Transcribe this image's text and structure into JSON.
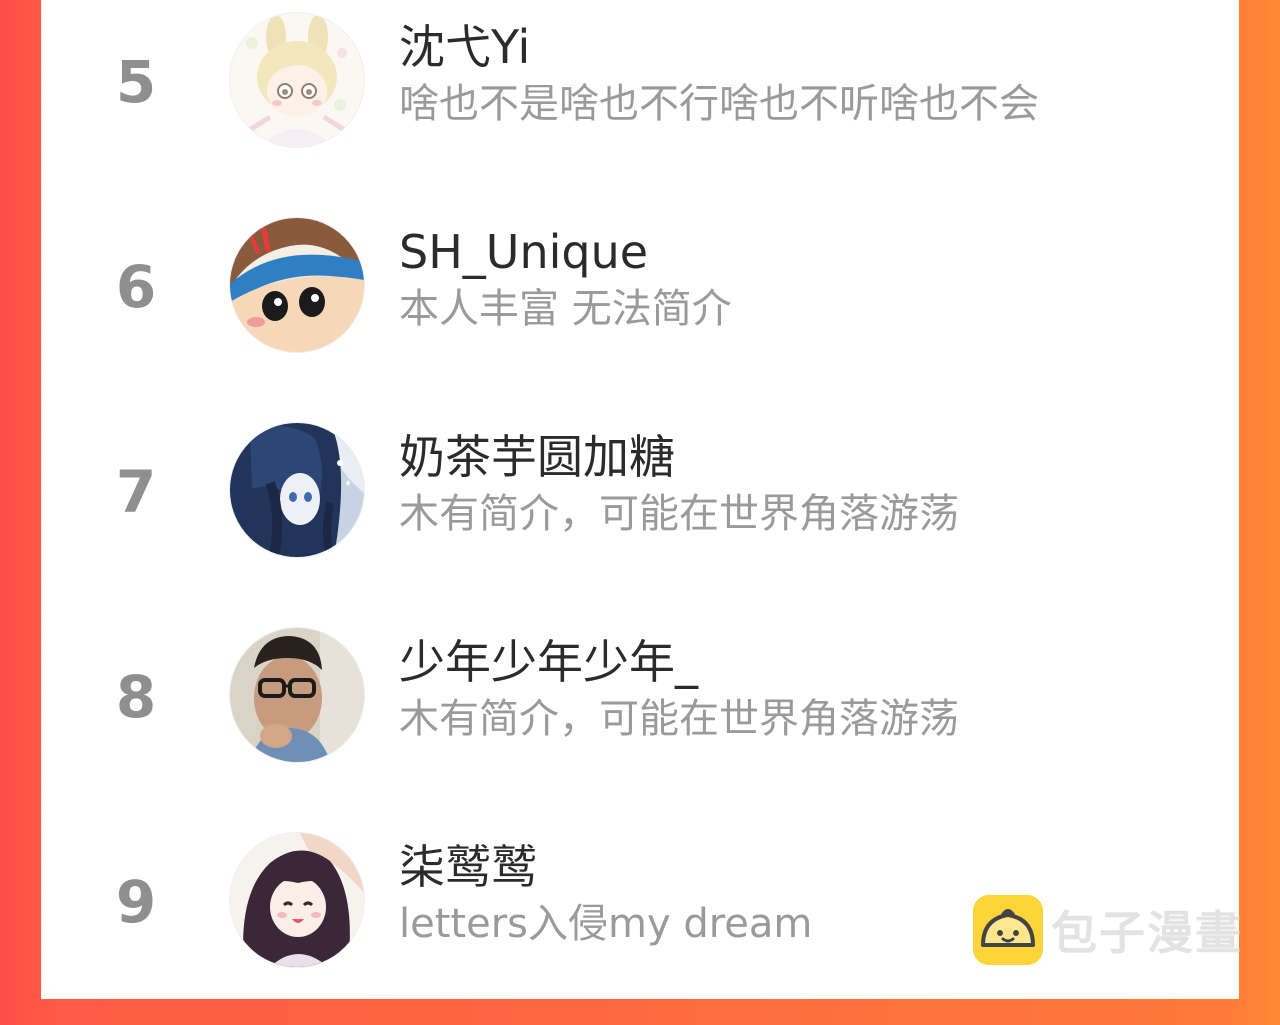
{
  "ranking": [
    {
      "rank": "5",
      "name": "沈弋Yi",
      "bio": "啥也不是啥也不行啥也不听啥也不会"
    },
    {
      "rank": "6",
      "name": "SH_Unique",
      "bio": "本人丰富 无法简介"
    },
    {
      "rank": "7",
      "name": "奶茶芋圆加糖",
      "bio": "木有简介，可能在世界角落游荡"
    },
    {
      "rank": "8",
      "name": "少年少年少年_",
      "bio": "木有简介，可能在世界角落游荡"
    },
    {
      "rank": "9",
      "name": "柒鹫鹫",
      "bio": "letters入侵my dream"
    }
  ],
  "watermark": {
    "text": "包子漫畫"
  },
  "colors": {
    "background_left": "#ff4d48",
    "background_right": "#ff8a34",
    "rank_gray": "#8f8f8f",
    "name_dark": "#2b2b2b",
    "bio_gray": "#9a9a9a",
    "logo_yellow": "#ffd22e"
  }
}
